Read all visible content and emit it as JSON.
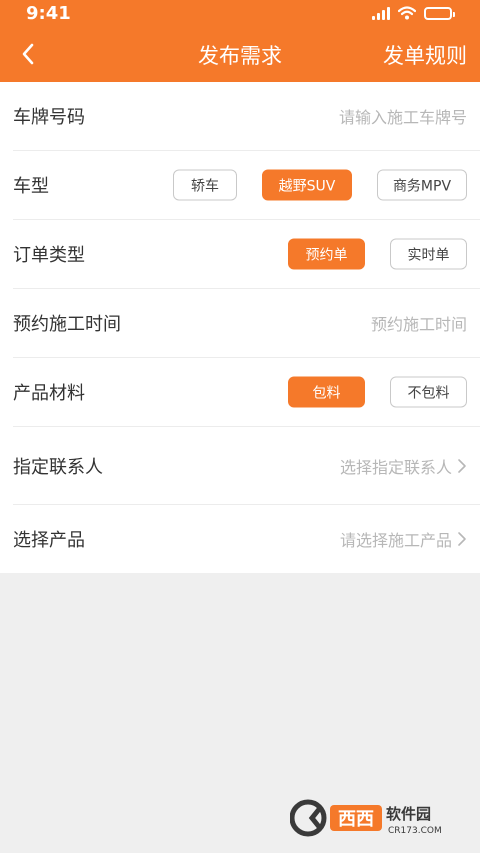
{
  "status_bar": {
    "time": "9:41"
  },
  "header": {
    "title": "发布需求",
    "rules_label": "发单规则"
  },
  "form": {
    "plate": {
      "label": "车牌号码",
      "placeholder": "请输入施工车牌号"
    },
    "vehicle_type": {
      "label": "车型",
      "options": [
        "轿车",
        "越野SUV",
        "商务MPV"
      ],
      "selected": "越野SUV"
    },
    "order_type": {
      "label": "订单类型",
      "options": [
        "预约单",
        "实时单"
      ],
      "selected": "预约单"
    },
    "service_time": {
      "label": "预约施工时间",
      "placeholder": "预约施工时间"
    },
    "materials": {
      "label": "产品材料",
      "options": [
        "包料",
        "不包料"
      ],
      "selected": "包料"
    },
    "contact": {
      "label": "指定联系人",
      "placeholder": "选择指定联系人"
    },
    "product": {
      "label": "选择产品",
      "placeholder": "请选择施工产品"
    }
  },
  "watermark": {
    "brand": "西西软件园",
    "url": "CR173.COM"
  },
  "colors": {
    "accent": "#f5792a",
    "background": "#efefef"
  }
}
